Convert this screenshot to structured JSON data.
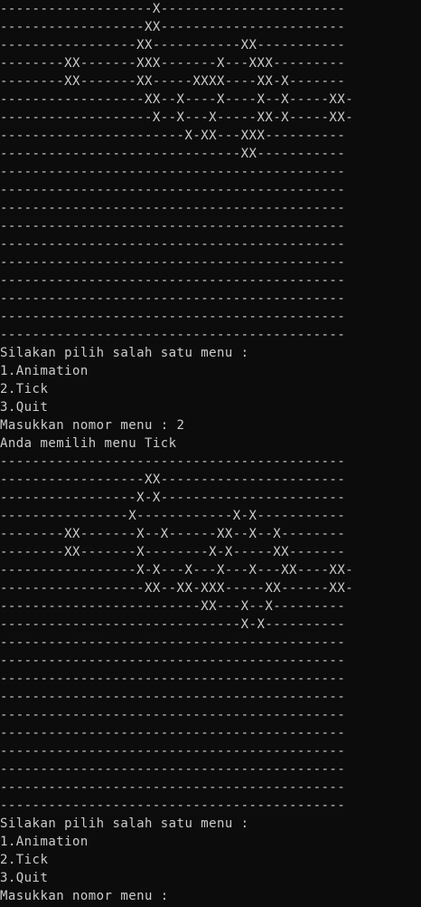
{
  "console": {
    "lines": [
      "-------------------X-----------------------",
      "------------------XX-----------------------",
      "-----------------XX-----------XX-----------",
      "--------XX-------XXX-------X---XXX---------",
      "--------XX-------XX-----XXXX----XX-X-------",
      "------------------XX--X----X----X--X-----XX-",
      "-------------------X--X---X-----XX-X-----XX-",
      "-----------------------X-XX---XXX----------",
      "------------------------------XX-----------",
      "-------------------------------------------",
      "-------------------------------------------",
      "-------------------------------------------",
      "-------------------------------------------",
      "-------------------------------------------",
      "-------------------------------------------",
      "-------------------------------------------",
      "-------------------------------------------",
      "-------------------------------------------",
      "-------------------------------------------",
      "Silakan pilih salah satu menu :",
      "1.Animation",
      "2.Tick",
      "3.Quit",
      "Masukkan nomor menu : 2",
      "Anda memilih menu Tick",
      "-------------------------------------------",
      "------------------XX-----------------------",
      "-----------------X-X-----------------------",
      "----------------X------------X-X-----------",
      "--------XX-------X--X------XX--X--X--------",
      "--------XX-------X--------X-X-----XX-------",
      "-----------------X-X---X---X---X---XX----XX-",
      "------------------XX--XX-XXX-----XX------XX-",
      "-------------------------XX---X--X---------",
      "------------------------------X-X----------",
      "-------------------------------------------",
      "-------------------------------------------",
      "-------------------------------------------",
      "-------------------------------------------",
      "-------------------------------------------",
      "-------------------------------------------",
      "-------------------------------------------",
      "-------------------------------------------",
      "-------------------------------------------",
      "-------------------------------------------",
      "Silakan pilih salah satu menu :",
      "1.Animation",
      "2.Tick",
      "3.Quit",
      "Masukkan nomor menu :"
    ]
  }
}
